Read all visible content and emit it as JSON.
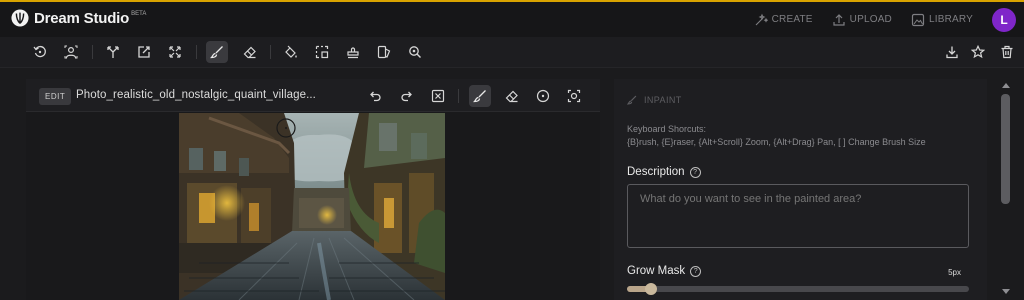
{
  "app": {
    "name": "Dream Studio",
    "beta": "BETA",
    "accent": "#d8a300"
  },
  "nav": {
    "create": "CREATE",
    "upload": "UPLOAD",
    "library": "LIBRARY",
    "avatar_letter": "L",
    "avatar_color": "#7f26c9"
  },
  "toolbar": {
    "icons": [
      "rotate-icon",
      "person-icon",
      "branch-icon",
      "edit-square-icon",
      "expand-icon",
      "brush-icon",
      "eraser-icon",
      "fill-icon",
      "select-icon",
      "stamp-icon",
      "layers-icon",
      "zoom-icon",
      "download-icon",
      "star-icon",
      "trash-icon"
    ],
    "active": "brush-icon"
  },
  "editor": {
    "badge": "EDIT",
    "filename": "Photo_realistic_old_nostalgic_quaint_village..."
  },
  "panel": {
    "mode": "INPAINT",
    "shortcut_title": "Keyboard Shorcuts:",
    "shortcut_text": "{B}rush, {E}raser, {Alt+Scroll} Zoom, {Alt+Drag} Pan, [ ] Change Brush Size",
    "description_label": "Description",
    "description_placeholder": "What do you want to see in the painted area?",
    "grow_mask_label": "Grow Mask",
    "grow_mask_value": "5px",
    "grow_mask_fraction": 0.07
  }
}
